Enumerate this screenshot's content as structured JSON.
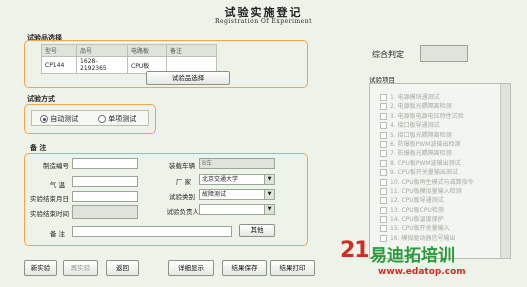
{
  "header": {
    "title": "试验实施登记",
    "subtitle": "Registration Of Experiment"
  },
  "sample": {
    "section_label": "试验品选择",
    "columns": [
      "型号",
      "品号",
      "电路板",
      "备注"
    ],
    "row": [
      "CP144",
      "1628-2192365",
      "CPU板",
      ""
    ],
    "select_button": "试验品选择"
  },
  "verdict": {
    "label": "综合判定",
    "value": ""
  },
  "method": {
    "section_label": "试验方式",
    "auto_label": "自动测试",
    "single_label": "单项测试",
    "selected": "auto"
  },
  "items": {
    "section_label": "试验项目",
    "list": [
      "1.  电源模块通测试",
      "2.  电源板光耦隔离检测",
      "3.  电源板电源电压特性试验",
      "4.  接口板导通测试",
      "5.  接口板光耦隔离检测",
      "6.  防爆板PWM波输出检测",
      "7.  防爆板光耦隔离检测",
      "8.  CPU板PWM波输出测试",
      "9.  CPU板开关量输出测试",
      "10. CPU板再生模式与减算指令",
      "11. CPU板模拟量输入检测",
      "12. CPU板导通测试",
      "13. CPU板CPU检测",
      "14. CPU板温度保护",
      "15. CPU板开关量输入",
      "16. 模拟驱动器信号输出"
    ]
  },
  "notes": {
    "section_label": "备 注",
    "fields": {
      "serial_label": "制造编号",
      "serial_value": "",
      "weather_label": "气  温",
      "weather_value": "",
      "end_date_label": "实验结束月日",
      "end_date_value": "",
      "end_time_label": "实验结束时间",
      "end_time_value": "",
      "vehicle_label": "装载车辆",
      "vehicle_value": "B车",
      "factory_label": "厂  家",
      "factory_value": "北京交通大学",
      "type_label": "试验类别",
      "type_value": "故障测试",
      "owner_label": "试验负责人",
      "owner_value": "",
      "remark_label": "备  注",
      "remark_value": "",
      "other_button": "其他"
    }
  },
  "footer": {
    "new": "新实验",
    "redo": "再实验",
    "back": "返回",
    "detail": "详细显示",
    "save": "结果保存",
    "print": "结果打印"
  },
  "watermark": {
    "number": "21",
    "cn": "易迪拓培训",
    "url": "www.edatop.com"
  }
}
